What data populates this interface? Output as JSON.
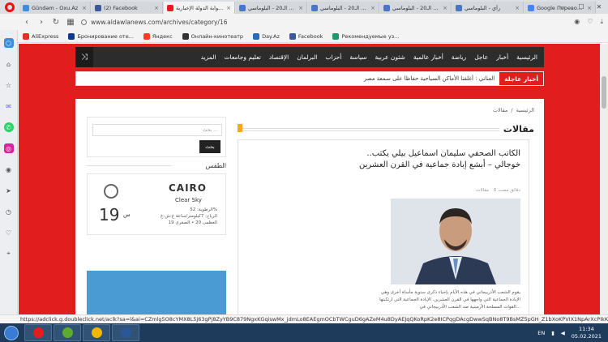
{
  "tabs": [
    {
      "label": "Gündəm - Oxu.Az",
      "color": "#3e8be0",
      "active": false
    },
    {
      "label": "(2) Facebook",
      "color": "#3b5998",
      "active": false
    },
    {
      "label": "بوابة الدولة الإخبارية - ...",
      "color": "#e11d1d",
      "active": true
    },
    {
      "label": "القرن الـ20 - البلوماسي",
      "color": "#4a76c6",
      "active": false
    },
    {
      "label": "القرن الـ20 - البلوماسي",
      "color": "#4a76c6",
      "active": false
    },
    {
      "label": "القرن الـ20 - البلوماسي",
      "color": "#4a76c6",
      "active": false
    },
    {
      "label": "رأي - البلوماسي",
      "color": "#4a76c6",
      "active": false
    },
    {
      "label": "Google Переводч...",
      "color": "#4285f4",
      "active": false
    }
  ],
  "address": {
    "url": "www.aldawlanews.com/archives/category/16"
  },
  "bookmarks": [
    {
      "label": "AliExpress",
      "color": "#e43225"
    },
    {
      "label": "Бронирование оте...",
      "color": "#0a3b8c"
    },
    {
      "label": "Яндекс",
      "color": "#fc3f1d"
    },
    {
      "label": "Онлайн-кинотеатр",
      "color": "#333333"
    },
    {
      "label": "Day.Az",
      "color": "#2a6bb8"
    },
    {
      "label": "Facebook",
      "color": "#3b5998"
    },
    {
      "label": "Рекомендуемые уз...",
      "color": "#1a9a6c"
    }
  ],
  "nav": {
    "home": "الرئيسية",
    "items": [
      "أخبار",
      "عاجل",
      "رياضة",
      "أخبار عالمية",
      "شئون عربية",
      "سياسة",
      "أحزاب",
      "البرلمان",
      "الإقتصاد",
      "تعليم وجامعات",
      "المزيد"
    ]
  },
  "breaking": {
    "tag": "أخبار عاجلة",
    "text": "العناني : أغلقنا الأماكن السياحية حفاظا على سمعة مصر"
  },
  "breadcrumb": {
    "home": "الرئيسية",
    "sep": "/",
    "current": "مقالات"
  },
  "section": {
    "title": "مقالات"
  },
  "article": {
    "title": "الكاتب الصحفي سليمان اسماعيل بيلي يكتب.. خوجالي – أبشع إبادة جماعية في القرن العشرين",
    "time": "6 دقائق مضت",
    "category": "مقالات",
    "excerpt": "يقوم الشعب الأذربيجاني في هذه الأيام بإحياء ذكرى سنوية مأساة أخرى وهي الإبادة الجماعية التي واجهها في القرن العشرين. الإبادة الجماعية التي ارتكبتها القوات المسلحة الأرمينية ضد الشعب الأذربيجاني في..."
  },
  "search": {
    "placeholder": "بحث ...",
    "button": "بحث"
  },
  "weather": {
    "section_title": "الطقس",
    "city": "CAIRO",
    "condition": "Clear Sky",
    "humidity": "الرطوبة: 52%",
    "wind": "الرياح: 7كيلومتر/ساعة غ-ش-غ",
    "range": "العظمى 20 • الصغرى 19",
    "temp": "19",
    "unit": "س"
  },
  "status_url": "https://adclick.g.doubleclick.net/aclk?sa=l&ai=CZmlg5O8cYMX8L5j63gPj8ZyYB9C879NgxKGqiswMx_jdmLo8EAEgmOCbTWCguD6gAZeM4u8DyAEJqQKoRpK2e8ICPqgDAcgDwwSqBNo8T9BsMZ5pGH_Z1bXoKPVIX1NpArXcPIkKF...",
  "taskbar": {
    "lang": "EN",
    "time": "11:34",
    "date": "05.02.2021",
    "apps": [
      {
        "name": "opera",
        "color": "#e11d1d"
      },
      {
        "name": "utorrent",
        "color": "#5dab2f"
      },
      {
        "name": "chrome",
        "color": "#f2b500"
      },
      {
        "name": "word",
        "color": "#2b5797"
      }
    ]
  }
}
